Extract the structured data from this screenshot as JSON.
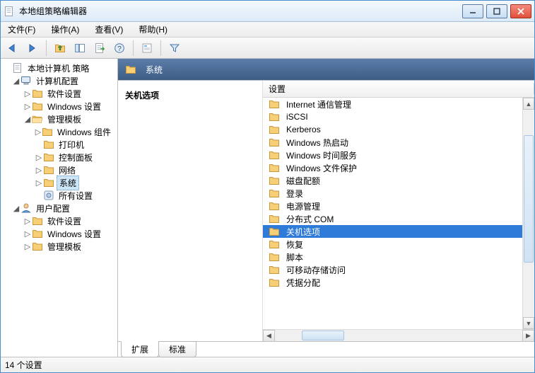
{
  "window": {
    "title": "本地组策略编辑器"
  },
  "menu": {
    "file": "文件(F)",
    "action": "操作(A)",
    "view": "查看(V)",
    "help": "帮助(H)"
  },
  "tree": {
    "root": "本地计算机 策略",
    "computer": "计算机配置",
    "comp_software": "软件设置",
    "comp_windows": "Windows 设置",
    "comp_admin": "管理模板",
    "comp_wincomp": "Windows 组件",
    "comp_printers": "打印机",
    "comp_controlpanel": "控制面板",
    "comp_network": "网络",
    "comp_system": "系统",
    "comp_allsettings": "所有设置",
    "user": "用户配置",
    "user_software": "软件设置",
    "user_windows": "Windows 设置",
    "user_admin": "管理模板"
  },
  "header": {
    "title": "系统"
  },
  "detail": {
    "heading": "关机选项"
  },
  "column_settings": "设置",
  "list_items": [
    {
      "label": "Internet 通信管理"
    },
    {
      "label": "iSCSI"
    },
    {
      "label": "Kerberos"
    },
    {
      "label": "Windows 热启动"
    },
    {
      "label": "Windows 时间服务"
    },
    {
      "label": "Windows 文件保护"
    },
    {
      "label": "磁盘配额"
    },
    {
      "label": "登录"
    },
    {
      "label": "电源管理"
    },
    {
      "label": "分布式 COM"
    },
    {
      "label": "关机选项"
    },
    {
      "label": "恢复"
    },
    {
      "label": "脚本"
    },
    {
      "label": "可移动存储访问"
    },
    {
      "label": "凭据分配"
    }
  ],
  "selected_list_index": 10,
  "tabs": {
    "extension": "扩展",
    "standard": "标准"
  },
  "status": {
    "count": "14 个设置"
  }
}
